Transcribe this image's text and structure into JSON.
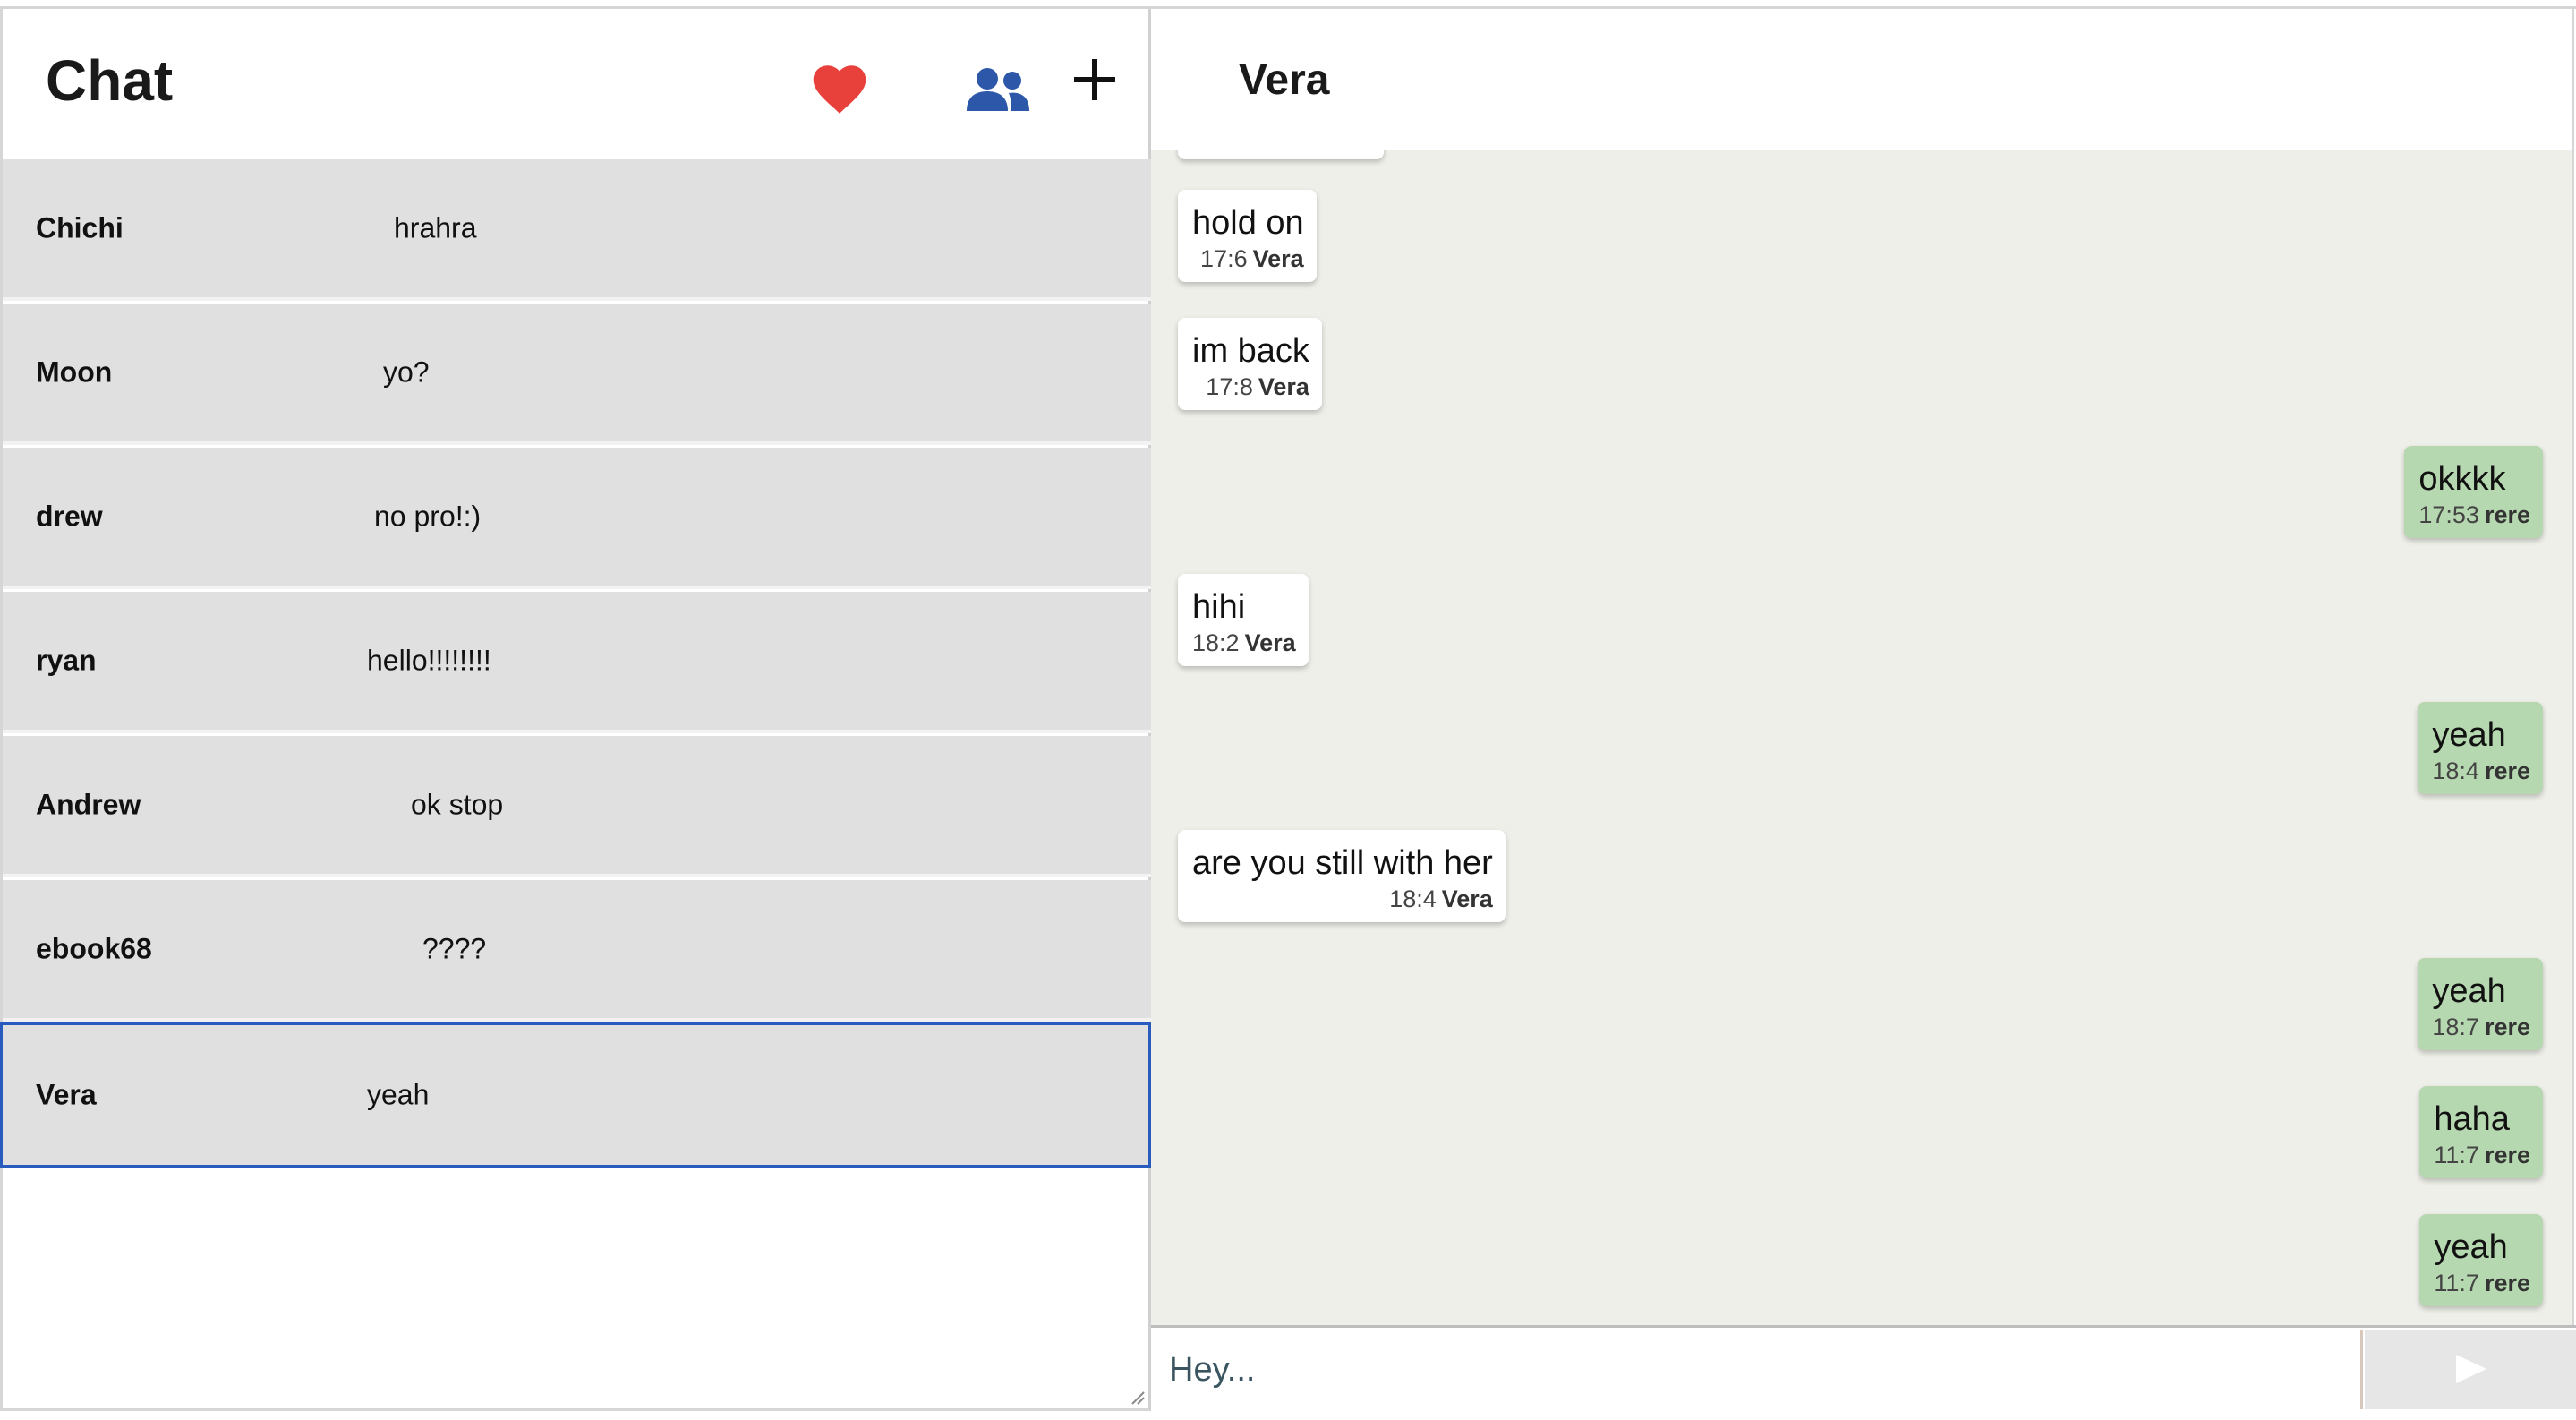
{
  "sidebar": {
    "title": "Chat",
    "icons": {
      "favorites": "heart-icon",
      "contacts": "users-icon",
      "new_chat": "plus-icon"
    },
    "conversations": [
      {
        "name": "Chichi",
        "preview": "hrahra"
      },
      {
        "name": "Moon",
        "preview": "yo?"
      },
      {
        "name": "drew",
        "preview": "no pro!:)"
      },
      {
        "name": "ryan",
        "preview": "hello!!!!!!!!"
      },
      {
        "name": "Andrew",
        "preview": "ok stop"
      },
      {
        "name": "ebook68",
        "preview": "????"
      },
      {
        "name": "Vera",
        "preview": "yeah",
        "active": true
      }
    ]
  },
  "chat": {
    "title": "Vera",
    "messages": [
      {
        "text": "hold on",
        "time": "17:6",
        "sender": "Vera",
        "direction": "in"
      },
      {
        "text": "im back",
        "time": "17:8",
        "sender": "Vera",
        "direction": "in"
      },
      {
        "text": "okkkk",
        "time": "17:53",
        "sender": "rere",
        "direction": "out"
      },
      {
        "text": "hihi",
        "time": "18:2",
        "sender": "Vera",
        "direction": "in"
      },
      {
        "text": "yeah",
        "time": "18:4",
        "sender": "rere",
        "direction": "out"
      },
      {
        "text": "are you still with her",
        "time": "18:4",
        "sender": "Vera",
        "direction": "in"
      },
      {
        "text": "yeah",
        "time": "18:7",
        "sender": "rere",
        "direction": "out"
      },
      {
        "text": "haha",
        "time": "11:7",
        "sender": "rere",
        "direction": "out"
      },
      {
        "text": "yeah",
        "time": "11:7",
        "sender": "rere",
        "direction": "out"
      }
    ],
    "composer": {
      "placeholder": "Hey...",
      "send_icon": "send-icon"
    }
  },
  "colors": {
    "heart": "#e8413c",
    "users": "#2d57a8",
    "outgoing_bubble": "#b6d8b0",
    "incoming_bubble": "#ffffff",
    "messages_bg": "#efefe9",
    "conv_bg": "#e0e0e0",
    "active_border": "#2a5bbf"
  }
}
